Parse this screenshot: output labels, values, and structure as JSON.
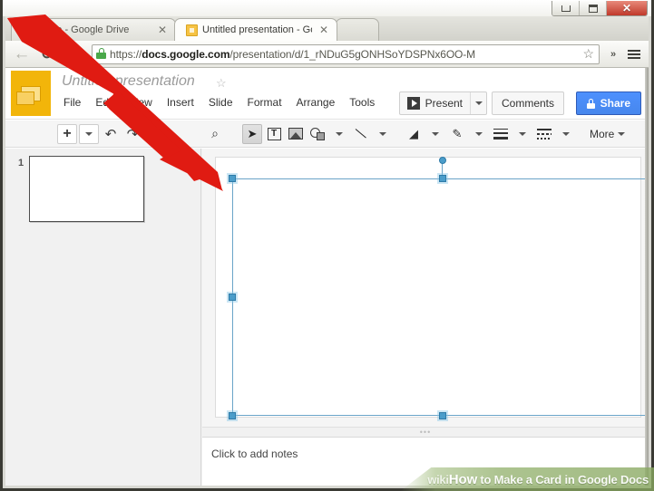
{
  "window": {
    "controls": {
      "minimize_label": "Minimize",
      "maximize_label": "Maximize",
      "close_label": "✕"
    }
  },
  "browser": {
    "tabs": [
      {
        "title": "My Drive - Google Drive",
        "close_label": "✕",
        "active": false
      },
      {
        "title": "Untitled presentation - Go",
        "close_label": "✕",
        "active": true
      }
    ],
    "nav": {
      "back_label": "←",
      "reload_label": "⟳",
      "home_label": "⌂",
      "star_label": "☆",
      "overflow_label": "»",
      "menu_label": "menu"
    },
    "url": {
      "scheme": "https://",
      "host": "docs.google.com",
      "path": "/presentation/d/1_rNDuG5gONHSoYDSPNx6OO-M",
      "full": "https://docs.google.com/presentation/d/1_rNDuG5gONHSoYDSPNx6OO-M"
    }
  },
  "docs": {
    "title": "Untitled presentation",
    "star_label": "☆",
    "menus": [
      "File",
      "Edit",
      "View",
      "Insert",
      "Slide",
      "Format",
      "Arrange",
      "Tools"
    ],
    "present_label": "Present",
    "comments_label": "Comments",
    "share_label": "Share"
  },
  "toolbar": {
    "new_slide_label": "+",
    "undo_label": "↶",
    "redo_label": "↷",
    "paint_format_label": "✐",
    "zoom_label": "⌕",
    "select_label": "➤",
    "textbox_label": "T",
    "image_label": "image",
    "shape_label": "shape",
    "line_label": "line",
    "fill_color_label": "◢",
    "line_color_label": "✎",
    "line_weight_label": "weight",
    "line_dash_label": "dash",
    "more_label": "More",
    "collapse_label": "⌃⌃",
    "caret_label": "▾"
  },
  "filmstrip": {
    "slides": [
      {
        "number": "1"
      }
    ]
  },
  "notes": {
    "placeholder": "Click to add notes",
    "grip_label": "•••"
  },
  "annotation": {
    "arrow_color": "#e01b12",
    "arrow_description": "red arrow pointing to slide canvas"
  },
  "watermark": {
    "wiki": "wiki",
    "how": "How",
    "rest": "to Make a Card in Google Docs",
    "color": "#8aa860"
  },
  "colors": {
    "share_blue": "#4d90fe",
    "slides_yellow": "#f2b50a",
    "selection_blue": "#4b9dca",
    "close_red": "#c0392b"
  }
}
